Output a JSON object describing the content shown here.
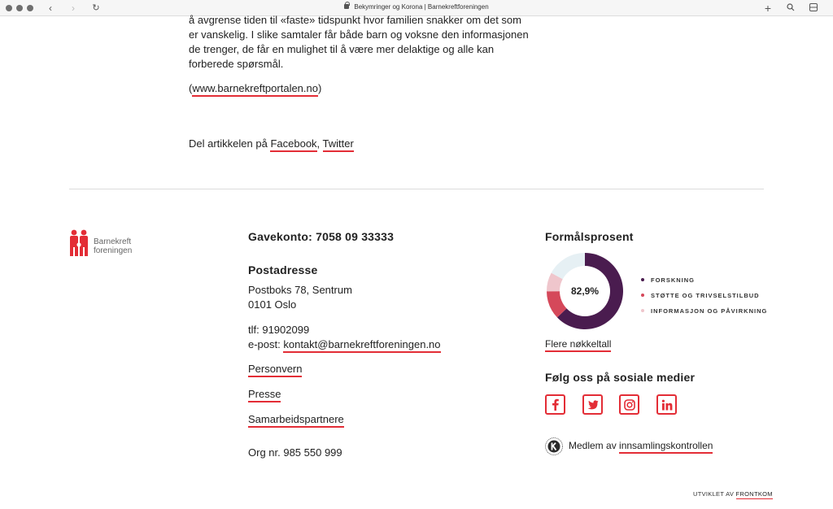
{
  "browser": {
    "tab_title": "Bekymringer og Korona | Barnekreftforeningen"
  },
  "article": {
    "lines": [
      "å avgrense tiden til «faste» tidspunkt hvor familien snakker om det som",
      "er vanskelig. I slike samtaler får både barn og voksne den informasjonen",
      "de trenger, de får en mulighet til å være mer delaktige og alle kan",
      "forberede spørsmål."
    ],
    "source_prefix": "(",
    "source_link": "www.barnekreftportalen.no",
    "source_suffix": ")",
    "share_prefix": "Del artikkelen på ",
    "share_facebook": "Facebook",
    "share_sep": ", ",
    "share_twitter": "Twitter"
  },
  "footer": {
    "logo": {
      "line1": "Barnekreft",
      "line2": "foreningen"
    },
    "gavekonto": "Gavekonto: 7058 09 33333",
    "postadresse_heading": "Postadresse",
    "address_line1": "Postboks 78, Sentrum",
    "address_line2": "0101 Oslo",
    "phone": "tlf: 91902099",
    "email_prefix": "e-post: ",
    "email": "kontakt@barnekreftforeningen.no",
    "links": [
      "Personvern",
      "Presse",
      "Samarbeidspartnere"
    ],
    "org_nr": "Org nr. 985 550 999",
    "formaal": {
      "heading": "Formålsprosent",
      "center_label": "82,9%",
      "segments": [
        {
          "label": "FORSKNING",
          "value": 62.9,
          "color": "#4a1c4f"
        },
        {
          "label": "STØTTE OG TRIVSELSTILBUD",
          "value": 12,
          "color": "#d5485a"
        },
        {
          "label": "INFORMASJON OG PÅVIRKNING",
          "value": 8,
          "color": "#efc6cc"
        }
      ],
      "remainder_color": "#e6f0f4",
      "more_link": "Flere nøkkeltall"
    },
    "social_heading": "Følg oss på sosiale medier",
    "social_icons": [
      "facebook-icon",
      "twitter-icon",
      "instagram-icon",
      "linkedin-icon"
    ],
    "member_prefix": "Medlem av ",
    "member_link": "innsamlingskontrollen",
    "credit_prefix": "UTVIKLET AV ",
    "credit_link": "FRONTKOM",
    "accent": "#e32d36"
  }
}
